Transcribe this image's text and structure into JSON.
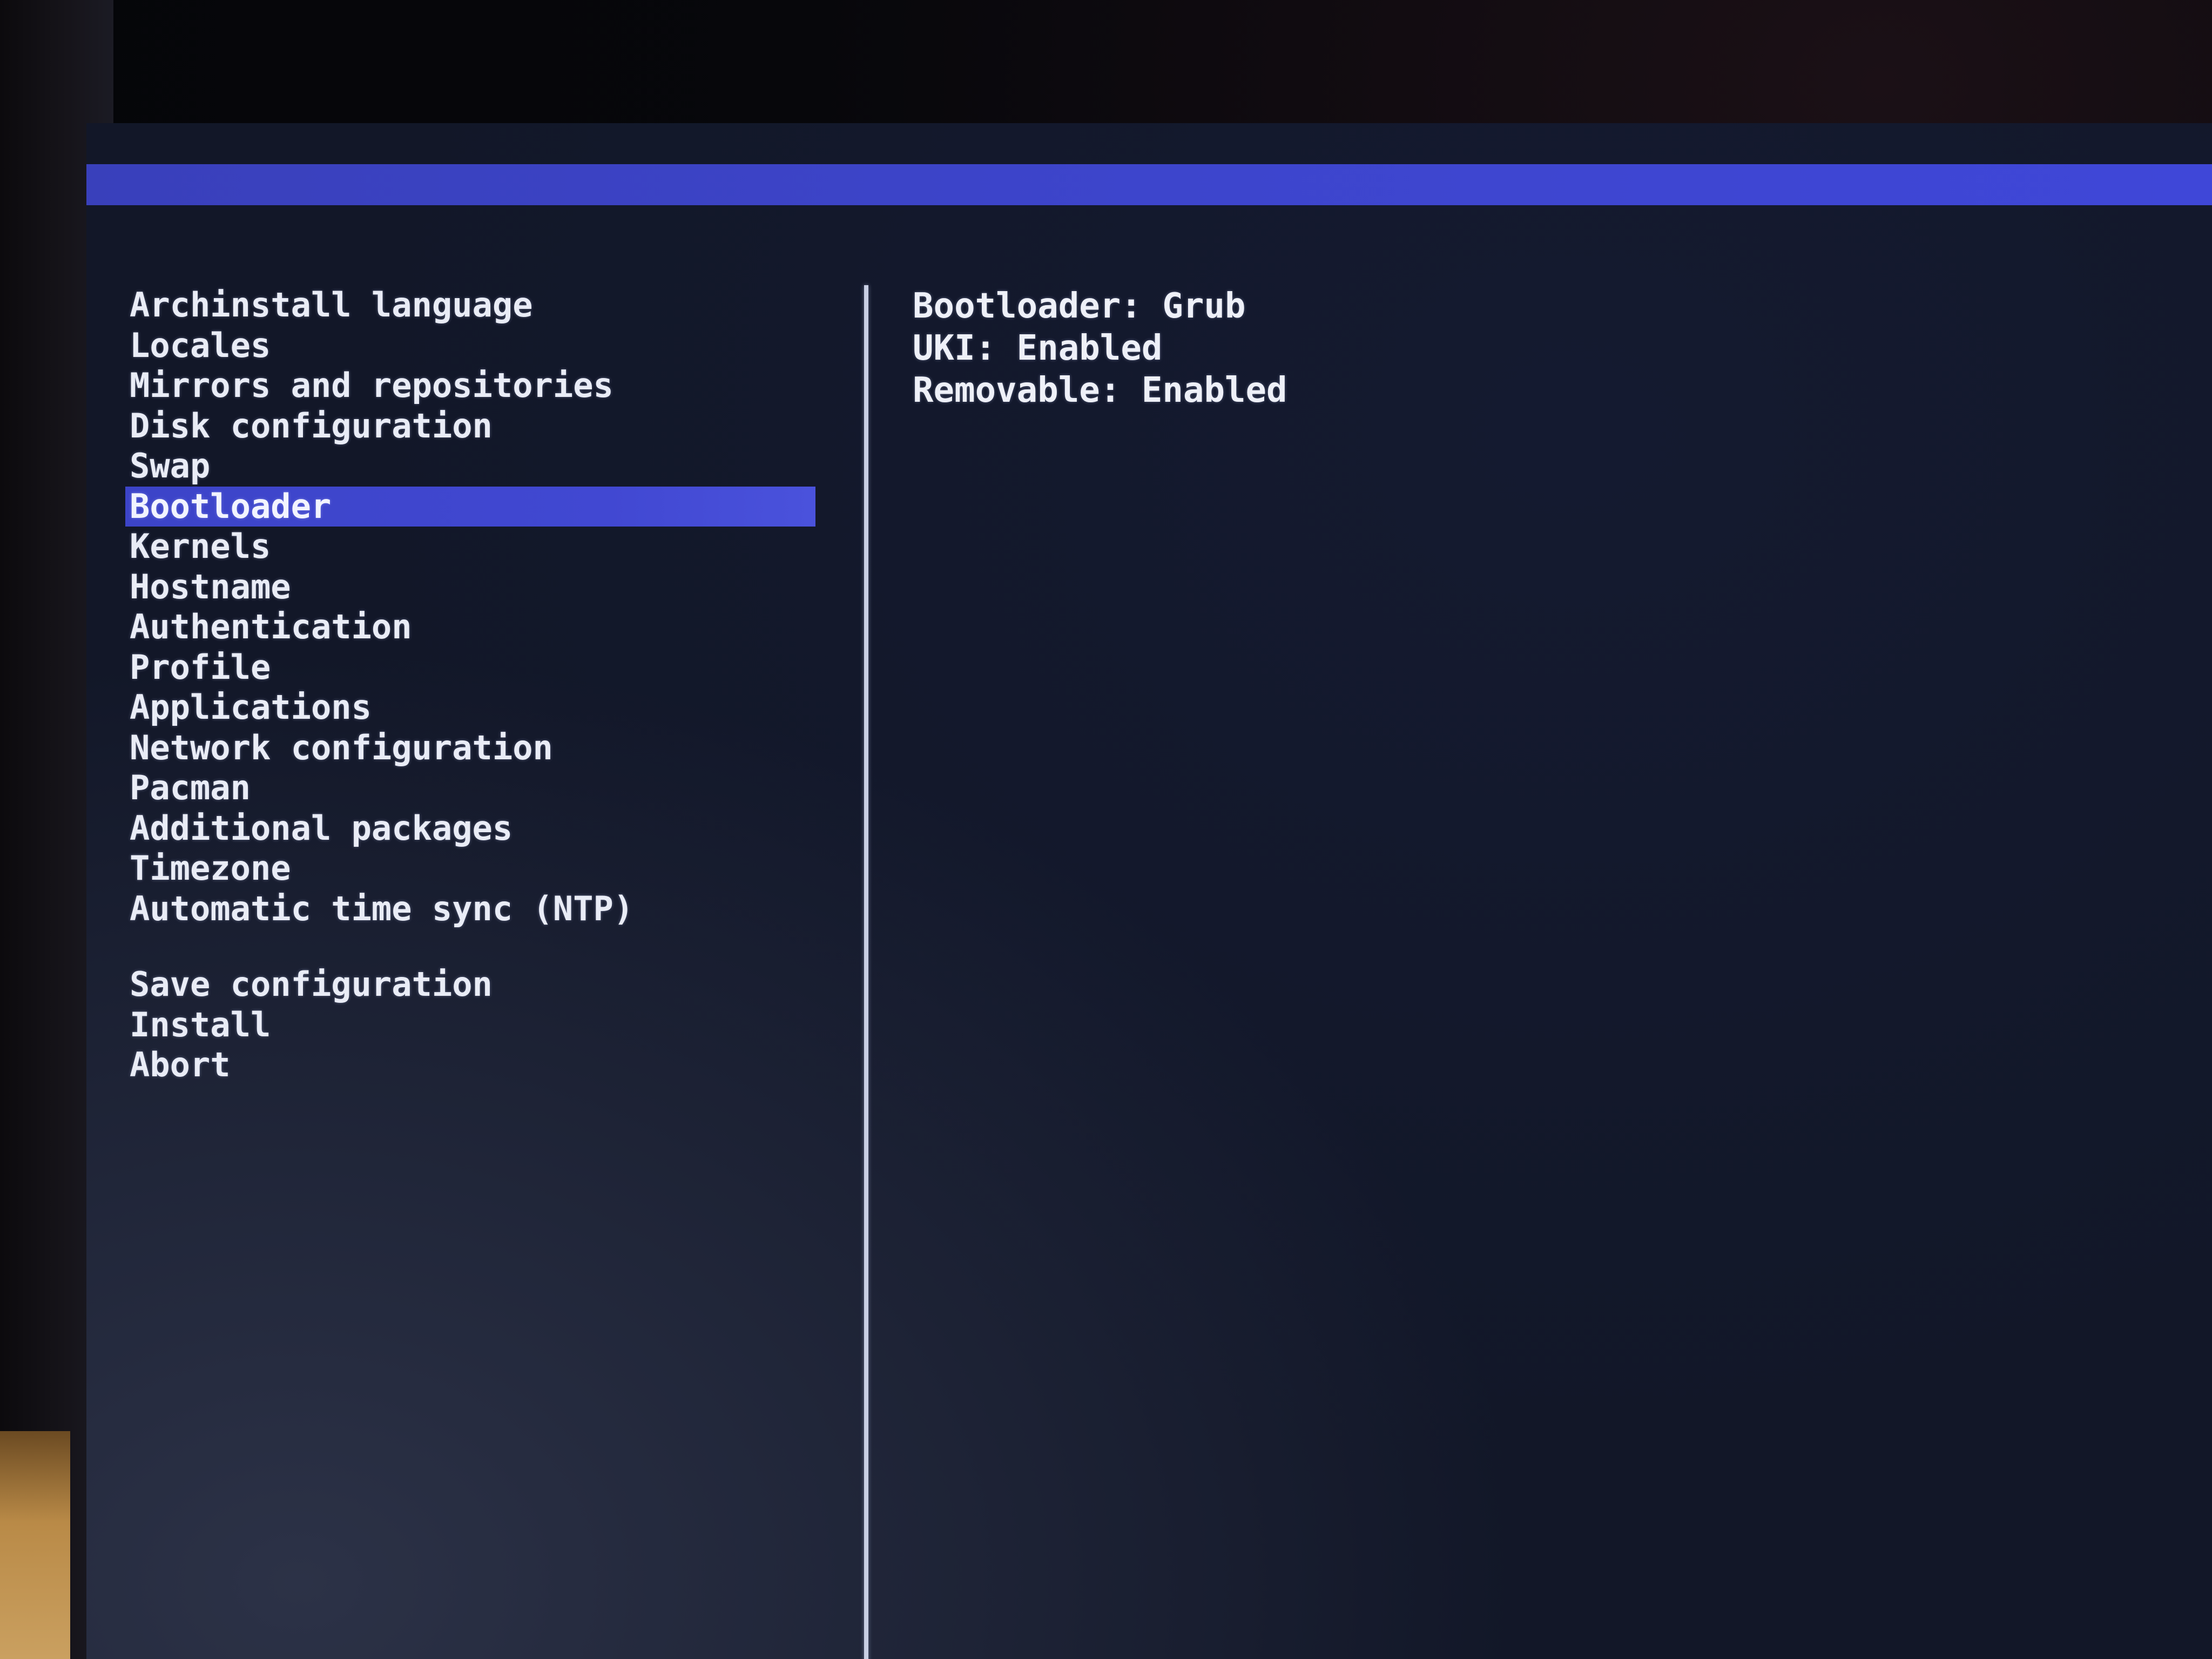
{
  "menu": {
    "items": [
      {
        "label": "Archinstall language"
      },
      {
        "label": "Locales"
      },
      {
        "label": "Mirrors and repositories"
      },
      {
        "label": "Disk configuration"
      },
      {
        "label": "Swap"
      },
      {
        "label": "Bootloader",
        "selected": true
      },
      {
        "label": "Kernels"
      },
      {
        "label": "Hostname"
      },
      {
        "label": "Authentication"
      },
      {
        "label": "Profile"
      },
      {
        "label": "Applications"
      },
      {
        "label": "Network configuration"
      },
      {
        "label": "Pacman"
      },
      {
        "label": "Additional packages"
      },
      {
        "label": "Timezone"
      },
      {
        "label": "Automatic time sync (NTP)"
      }
    ],
    "actions": [
      {
        "label": "Save configuration"
      },
      {
        "label": "Install"
      },
      {
        "label": "Abort"
      }
    ]
  },
  "details": {
    "lines": [
      "Bootloader: Grub",
      "UKI: Enabled",
      "Removable: Enabled"
    ]
  },
  "colors": {
    "accent": "#3d45cc",
    "background": "#121728",
    "text": "#e9ecf6"
  }
}
